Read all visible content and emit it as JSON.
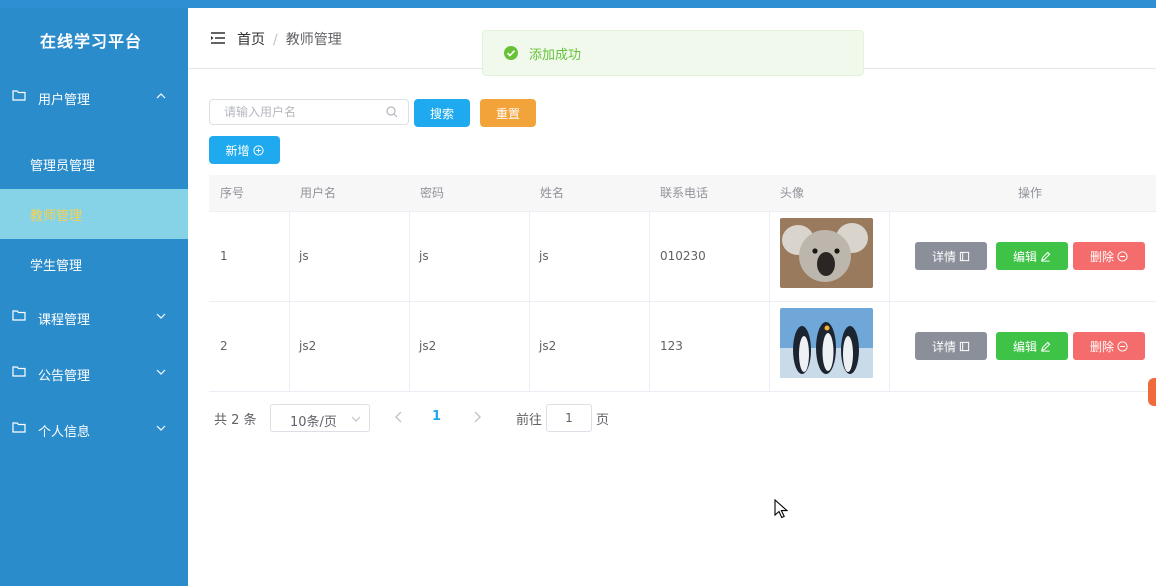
{
  "app": {
    "title": "在线学习平台"
  },
  "sidebar": {
    "groups": [
      {
        "label": "用户管理",
        "items": [
          "管理员管理",
          "教师管理",
          "学生管理"
        ],
        "active_item": "教师管理"
      },
      {
        "label": "课程管理"
      },
      {
        "label": "公告管理"
      },
      {
        "label": "个人信息"
      }
    ]
  },
  "breadcrumb": {
    "home": "首页",
    "separator": "/",
    "current": "教师管理"
  },
  "toast": {
    "message": "添加成功"
  },
  "search": {
    "placeholder": "请输入用户名",
    "value": "",
    "search_label": "搜索",
    "reset_label": "重置",
    "add_label": "新增"
  },
  "table": {
    "columns": [
      "序号",
      "用户名",
      "密码",
      "姓名",
      "联系电话",
      "头像",
      "操作"
    ],
    "rows": [
      {
        "index": "1",
        "username": "js",
        "password": "js",
        "name": "js",
        "phone": "010230",
        "avatar": "koala-photo"
      },
      {
        "index": "2",
        "username": "js2",
        "password": "js2",
        "name": "js2",
        "phone": "123",
        "avatar": "penguins-photo"
      }
    ],
    "actions": {
      "detail": "详情",
      "edit": "编辑",
      "delete": "删除"
    }
  },
  "pagination": {
    "total_text": "共 2 条",
    "page_size": "10条/页",
    "current_page": "1",
    "goto_prefix": "前往",
    "goto_value": "1",
    "goto_suffix": "页"
  },
  "colors": {
    "sidebar_bg": "#2b8ccb",
    "active_item_bg": "#86d3e8",
    "active_item_text": "#f6d24e",
    "primary": "#1fa9ee",
    "warning": "#f2a33a",
    "success": "#3ec347",
    "danger": "#f56c6c",
    "info": "#8a8f99"
  }
}
